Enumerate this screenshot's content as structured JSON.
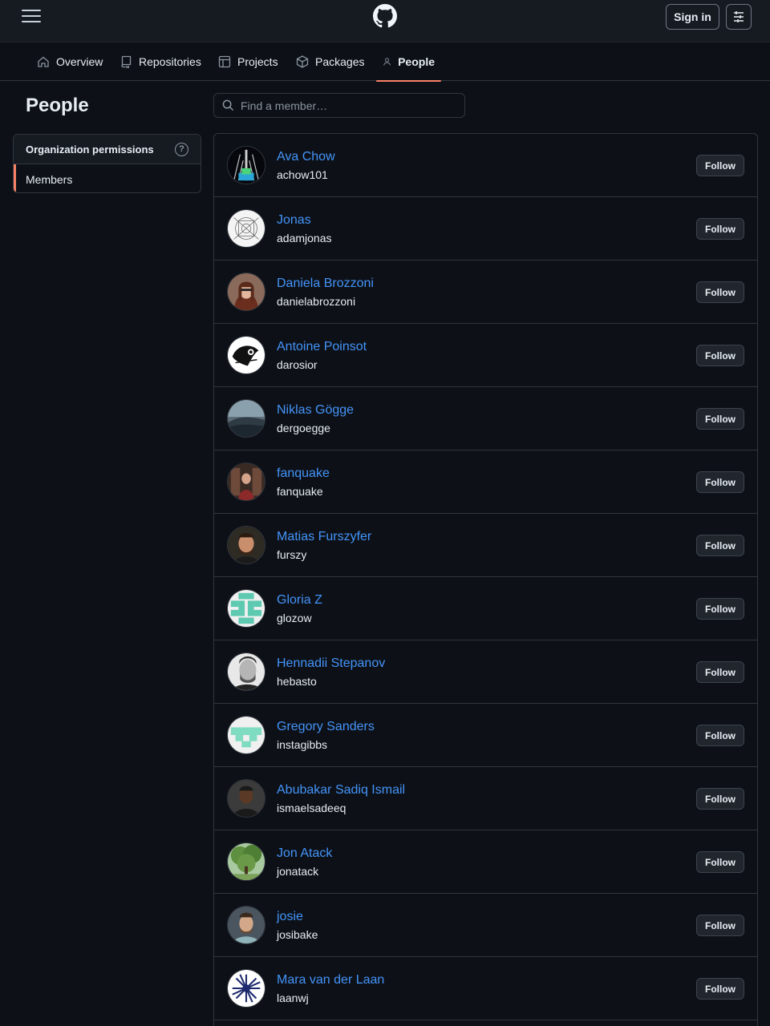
{
  "header": {
    "menu_icon": "hamburger-icon",
    "logo_icon": "github-mark-icon",
    "signin_label": "Sign in",
    "settings_icon": "sliders-icon"
  },
  "nav": {
    "tabs": [
      {
        "label": "Overview",
        "icon": "home-icon"
      },
      {
        "label": "Repositories",
        "icon": "repo-icon"
      },
      {
        "label": "Projects",
        "icon": "table-icon"
      },
      {
        "label": "Packages",
        "icon": "package-icon"
      },
      {
        "label": "People",
        "icon": "person-icon",
        "active": true
      }
    ]
  },
  "sidebar": {
    "title": "People",
    "permissions_label": "Organization permissions",
    "help_icon": "question-icon",
    "members_label": "Members"
  },
  "search": {
    "placeholder": "Find a member…",
    "value": ""
  },
  "members": [
    {
      "name": "Ava Chow",
      "login": "achow101",
      "follow": "Follow"
    },
    {
      "name": "Jonas",
      "login": "adamjonas",
      "follow": "Follow"
    },
    {
      "name": "Daniela Brozzoni",
      "login": "danielabrozzoni",
      "follow": "Follow"
    },
    {
      "name": "Antoine Poinsot",
      "login": "darosior",
      "follow": "Follow"
    },
    {
      "name": "Niklas Gögge",
      "login": "dergoegge",
      "follow": "Follow"
    },
    {
      "name": "fanquake",
      "login": "fanquake",
      "follow": "Follow"
    },
    {
      "name": "Matias Furszyfer",
      "login": "furszy",
      "follow": "Follow"
    },
    {
      "name": "Gloria Z",
      "login": "glozow",
      "follow": "Follow"
    },
    {
      "name": "Hennadii Stepanov",
      "login": "hebasto",
      "follow": "Follow"
    },
    {
      "name": "Gregory Sanders",
      "login": "instagibbs",
      "follow": "Follow"
    },
    {
      "name": "Abubakar Sadiq Ismail",
      "login": "ismaelsadeeq",
      "follow": "Follow"
    },
    {
      "name": "Jon Atack",
      "login": "jonatack",
      "follow": "Follow"
    },
    {
      "name": "josie",
      "login": "josibake",
      "follow": "Follow"
    },
    {
      "name": "Mara van der Laan",
      "login": "laanwj",
      "follow": "Follow"
    }
  ],
  "colors": {
    "background": "#0d1117",
    "link": "#4493f8",
    "accent_underline": "#f78166",
    "border": "#30363d"
  }
}
